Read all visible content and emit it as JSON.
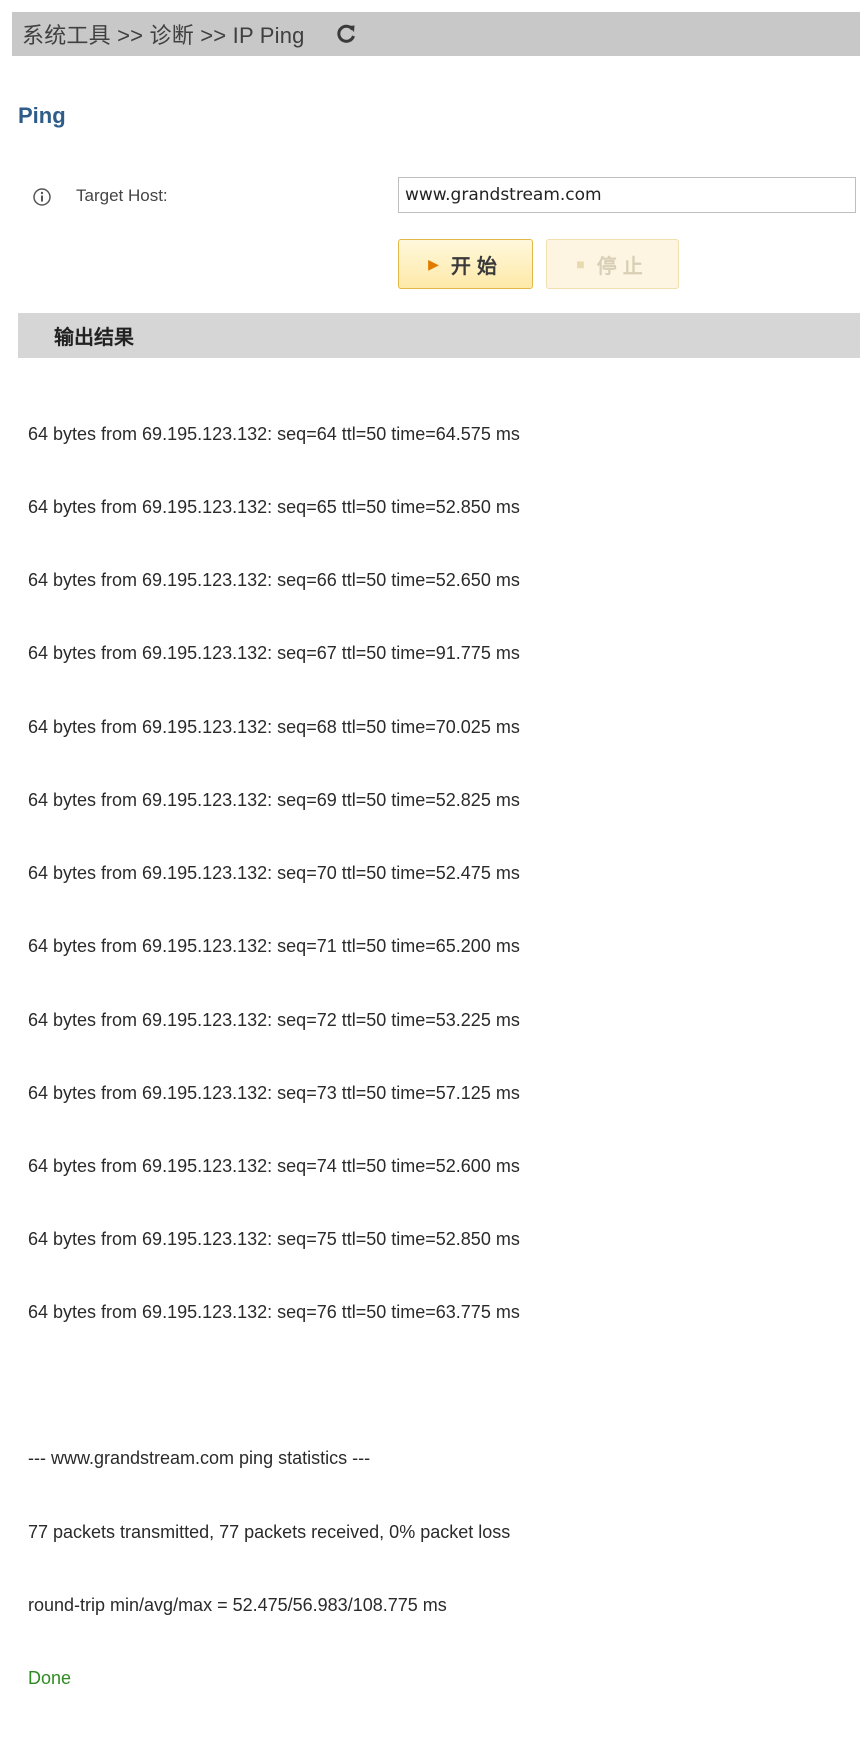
{
  "breadcrumb": {
    "text": "系统工具 >> 诊断 >> IP Ping",
    "refresh_icon": "refresh-icon"
  },
  "section": {
    "title": "Ping"
  },
  "target": {
    "label": "Target Host:",
    "value": "www.grandstream.com",
    "info_icon": "info-icon"
  },
  "buttons": {
    "start_label": "开始",
    "stop_label": "停止",
    "stop_enabled": false
  },
  "output": {
    "header": "输出结果",
    "lines": [
      "64 bytes from 69.195.123.132: seq=64 ttl=50 time=64.575 ms",
      "64 bytes from 69.195.123.132: seq=65 ttl=50 time=52.850 ms",
      "64 bytes from 69.195.123.132: seq=66 ttl=50 time=52.650 ms",
      "64 bytes from 69.195.123.132: seq=67 ttl=50 time=91.775 ms",
      "64 bytes from 69.195.123.132: seq=68 ttl=50 time=70.025 ms",
      "64 bytes from 69.195.123.132: seq=69 ttl=50 time=52.825 ms",
      "64 bytes from 69.195.123.132: seq=70 ttl=50 time=52.475 ms",
      "64 bytes from 69.195.123.132: seq=71 ttl=50 time=65.200 ms",
      "64 bytes from 69.195.123.132: seq=72 ttl=50 time=53.225 ms",
      "64 bytes from 69.195.123.132: seq=73 ttl=50 time=57.125 ms",
      "64 bytes from 69.195.123.132: seq=74 ttl=50 time=52.600 ms",
      "64 bytes from 69.195.123.132: seq=75 ttl=50 time=52.850 ms",
      "64 bytes from 69.195.123.132: seq=76 ttl=50 time=63.775 ms"
    ],
    "stats_header": "--- www.grandstream.com ping statistics ---",
    "stats_packets": "77 packets transmitted, 77 packets received, 0% packet loss",
    "stats_rtt": "round-trip min/avg/max = 52.475/56.983/108.775 ms",
    "status": "Done"
  },
  "colors": {
    "section_title": "#2f5d8a",
    "done": "#2e8b22",
    "start_accent": "#e07b00",
    "header_bg": "#c8c8c8"
  }
}
